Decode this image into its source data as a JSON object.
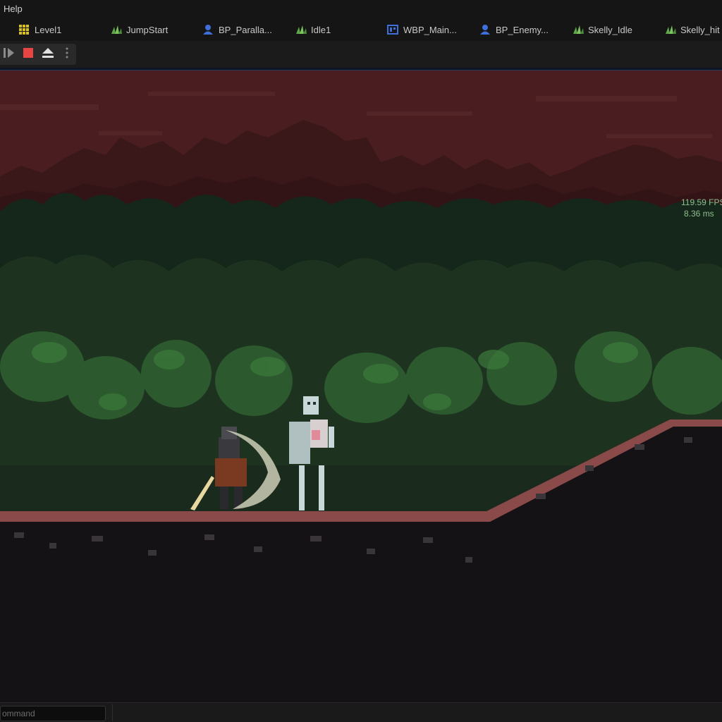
{
  "menu": {
    "help_label": "Help"
  },
  "tabs": [
    {
      "label": "Level1",
      "icon": "level-grid-icon"
    },
    {
      "label": "JumpStart",
      "icon": "animation-icon"
    },
    {
      "label": "BP_Paralla...",
      "icon": "blueprint-icon"
    },
    {
      "label": "Idle1",
      "icon": "animation-icon"
    },
    {
      "label": "WBP_Main...",
      "icon": "widget-blueprint-icon"
    },
    {
      "label": "BP_Enemy...",
      "icon": "blueprint-icon"
    },
    {
      "label": "Skelly_Idle",
      "icon": "animation-icon"
    },
    {
      "label": "Skelly_hit",
      "icon": "animation-icon"
    }
  ],
  "toolbar": {
    "buttons": [
      "step-frame-icon",
      "stop-icon",
      "eject-icon",
      "more-options-icon"
    ],
    "colors": {
      "stop": "#e84545"
    }
  },
  "viewport": {
    "stats": {
      "fps": "119.59 FPS",
      "ms": "8.36 ms"
    },
    "colors": {
      "sky": "#4a1e20",
      "foliage": "#1f3a22",
      "ground_top": "#8a4a4a",
      "ground": "#141214"
    }
  },
  "console": {
    "placeholder": "ommand"
  }
}
